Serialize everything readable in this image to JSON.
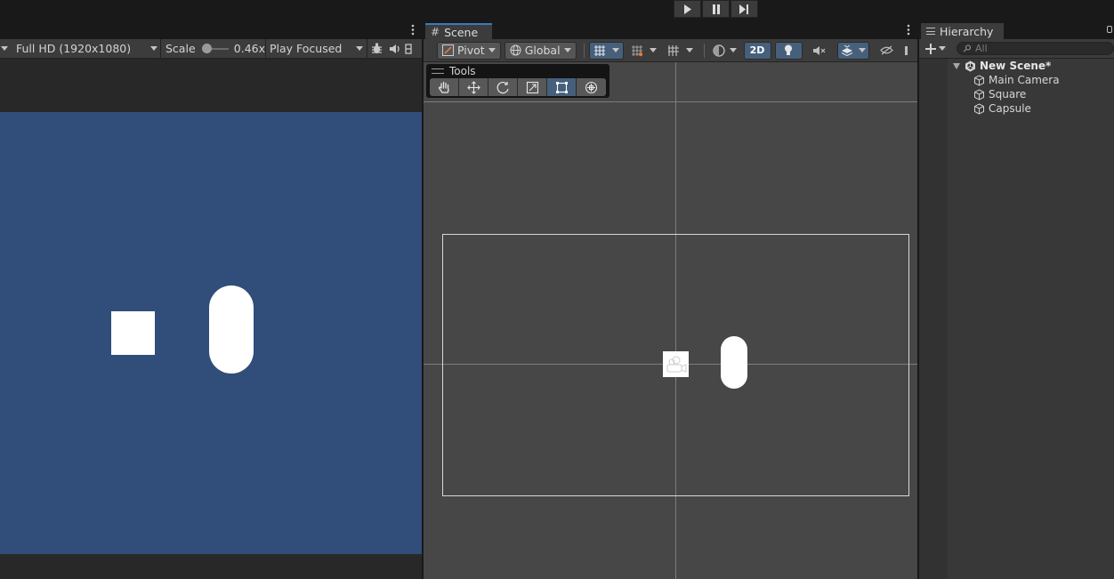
{
  "playbar": {
    "play": "play-icon",
    "pause": "pause-icon",
    "step": "step-icon"
  },
  "game": {
    "toolbar": {
      "resolution": "Full HD (1920x1080)",
      "scale_label": "Scale",
      "scale_value": "0.46x",
      "play_mode": "Play Focused"
    },
    "background_color": "#314d79"
  },
  "scene": {
    "tab_label": "Scene",
    "toolbar": {
      "pivot": "Pivot",
      "global": "Global",
      "mode_2d": "2D"
    },
    "tools": {
      "title": "Tools",
      "buttons": [
        "hand-tool-icon",
        "move-tool-icon",
        "rotate-tool-icon",
        "scale-tool-icon",
        "rect-tool-icon",
        "transform-tool-icon"
      ],
      "active": "rect-tool-icon"
    },
    "background_color": "#474747"
  },
  "hierarchy": {
    "tab_label": "Hierarchy",
    "search_placeholder": "All",
    "scene_name": "New Scene*",
    "items": [
      {
        "label": "Main Camera"
      },
      {
        "label": "Square"
      },
      {
        "label": "Capsule"
      }
    ]
  },
  "colors": {
    "accent": "#3a79bb",
    "active_button": "#46607c"
  }
}
